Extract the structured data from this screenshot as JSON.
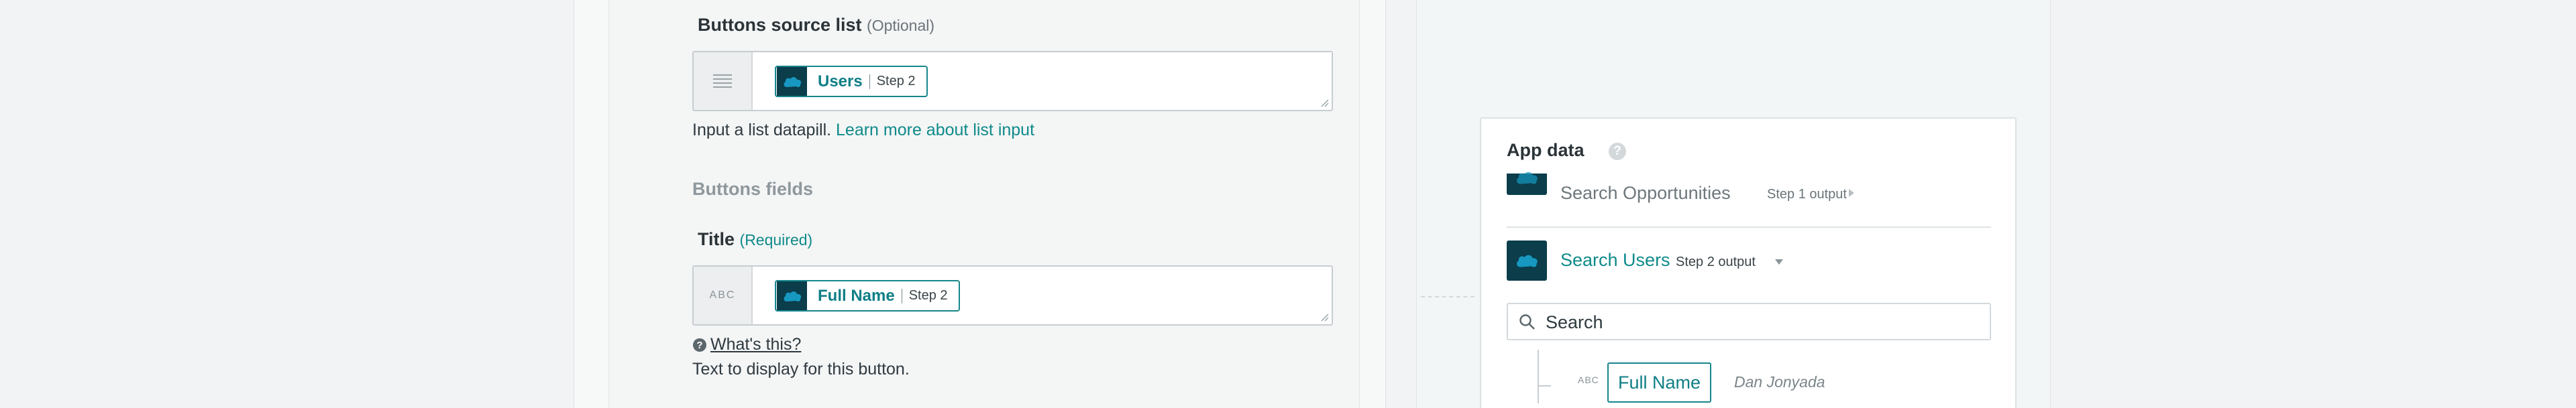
{
  "left_panel": {
    "buttons_source": {
      "label": "Buttons source list",
      "qualifier": "(Optional)",
      "type_icon": "list-lines-icon",
      "pill": {
        "name": "Users",
        "step": "Step 2",
        "icon": "salesforce-icon"
      },
      "help_text": "Input a list datapill. ",
      "help_link": "Learn more about list input"
    },
    "section_heading": "Buttons fields",
    "title_field": {
      "label": "Title",
      "qualifier": "(Required)",
      "type_label": "ABC",
      "pill": {
        "name": "Full Name",
        "step": "Step 2",
        "icon": "salesforce-icon"
      },
      "whats_this": "What's this?",
      "hint": "Text to display for this button."
    }
  },
  "app_data": {
    "title": "App data",
    "help_icon": "?",
    "rows": [
      {
        "title": "Search Opportunities",
        "step": "Step 1 output",
        "expanded": false,
        "icon": "salesforce-icon"
      },
      {
        "title": "Search Users",
        "step": "Step 2 output",
        "expanded": true,
        "icon": "salesforce-icon"
      }
    ],
    "search_placeholder": "Search",
    "fields": [
      {
        "type_label": "ABC",
        "name": "Full Name",
        "sample": "Dan Jonyada"
      }
    ]
  },
  "colors": {
    "accent": "#0f8a8a",
    "salesforce_tile": "#0b3d4b",
    "salesforce_cloud": "#1798c1"
  }
}
